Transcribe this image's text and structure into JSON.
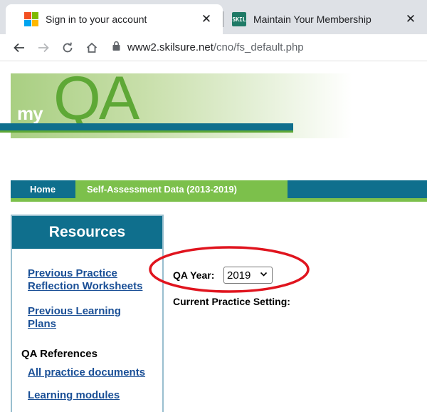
{
  "browser": {
    "tabs": [
      {
        "title": "Sign in to your account",
        "icon": "microsoft-logo-icon",
        "active": true
      },
      {
        "title": "Maintain Your Membership",
        "icon": "skilsure-favicon-icon",
        "active": false
      }
    ],
    "close_glyph": "✕",
    "url_host": "www2.skilsure.net",
    "url_path": "/cno/fs_default.php",
    "favicon_text": "SKIL"
  },
  "header": {
    "logo_prefix": "my",
    "logo_main": "QA"
  },
  "nav": {
    "home": "Home",
    "self_assessment": "Self-Assessment Data (2013-2019)"
  },
  "sidebar": {
    "title": "Resources",
    "link1": "Previous Practice Reflection Worksheets",
    "link2": "Previous Learning Plans",
    "references_heading": "QA References",
    "link3": "All practice documents",
    "link4": "Learning modules"
  },
  "main": {
    "qa_year_label": "QA Year:",
    "qa_year_value": "2019",
    "practice_setting_label": "Current Practice Setting:"
  },
  "colors": {
    "nav_blue": "#0f6f8d",
    "nav_green": "#7cc04b",
    "link_blue": "#1a4f96",
    "highlight_red": "#e0141e"
  }
}
